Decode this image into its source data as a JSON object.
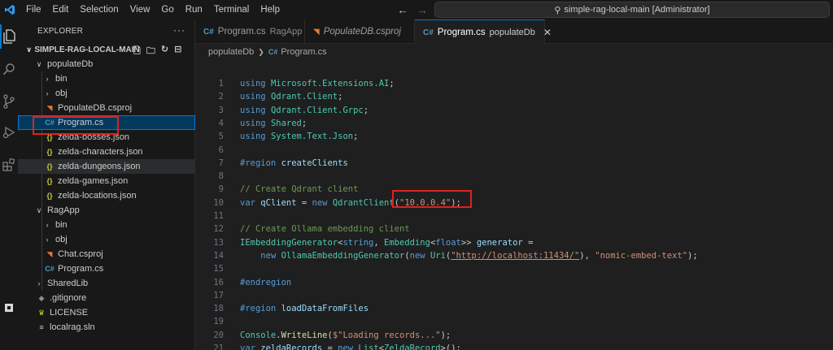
{
  "menu": [
    "File",
    "Edit",
    "Selection",
    "View",
    "Go",
    "Run",
    "Terminal",
    "Help"
  ],
  "command_center": "simple-rag-local-main [Administrator]",
  "explorer": {
    "title": "EXPLORER",
    "root": "SIMPLE-RAG-LOCAL-MAIN",
    "items": [
      {
        "label": "populateDb",
        "type": "folder-open",
        "depth": 1
      },
      {
        "label": "bin",
        "type": "folder",
        "depth": 2
      },
      {
        "label": "obj",
        "type": "folder",
        "depth": 2
      },
      {
        "label": "PopulateDB.csproj",
        "type": "csproj",
        "depth": 2
      },
      {
        "label": "Program.cs",
        "type": "cs",
        "depth": 2
      },
      {
        "label": "zelda-bosses.json",
        "type": "json",
        "depth": 2
      },
      {
        "label": "zelda-characters.json",
        "type": "json",
        "depth": 2
      },
      {
        "label": "zelda-dungeons.json",
        "type": "json",
        "depth": 2
      },
      {
        "label": "zelda-games.json",
        "type": "json",
        "depth": 2
      },
      {
        "label": "zelda-locations.json",
        "type": "json",
        "depth": 2
      },
      {
        "label": "RagApp",
        "type": "folder-open",
        "depth": 1
      },
      {
        "label": "bin",
        "type": "folder",
        "depth": 2
      },
      {
        "label": "obj",
        "type": "folder",
        "depth": 2
      },
      {
        "label": "Chat.csproj",
        "type": "csproj",
        "depth": 2
      },
      {
        "label": "Program.cs",
        "type": "cs",
        "depth": 2
      },
      {
        "label": "SharedLib",
        "type": "folder",
        "depth": 1
      },
      {
        "label": ".gitignore",
        "type": "git",
        "depth": 1
      },
      {
        "label": "LICENSE",
        "type": "license",
        "depth": 1
      },
      {
        "label": "localrag.sln",
        "type": "sln",
        "depth": 1
      }
    ]
  },
  "tabs": [
    {
      "name": "Program.cs",
      "desc": "RagApp",
      "icon": "cs"
    },
    {
      "name": "PopulateDB.csproj",
      "desc": "",
      "icon": "csproj"
    },
    {
      "name": "Program.cs",
      "desc": "populateDb",
      "icon": "cs",
      "active": true
    }
  ],
  "breadcrumb": [
    "populateDb",
    "Program.cs"
  ],
  "code_lines": [
    {
      "n": "1",
      "html": "<span class='kw'>using</span> <span class='ty'>Microsoft.Extensions.AI</span>;"
    },
    {
      "n": "2",
      "html": "<span class='kw'>using</span> <span class='ty'>Qdrant.Client</span>;"
    },
    {
      "n": "3",
      "html": "<span class='kw'>using</span> <span class='ty'>Qdrant.Client.Grpc</span>;"
    },
    {
      "n": "4",
      "html": "<span class='kw'>using</span> <span class='ty'>Shared</span>;"
    },
    {
      "n": "5",
      "html": "<span class='kw'>using</span> <span class='ty'>System.Text.Json</span>;"
    },
    {
      "n": "6",
      "html": ""
    },
    {
      "n": "7",
      "html": "<span class='rg'>#region</span> <span class='vr'>createClients</span>"
    },
    {
      "n": "8",
      "html": ""
    },
    {
      "n": "9",
      "html": "<span class='cm'>// Create Qdrant client</span>"
    },
    {
      "n": "10",
      "html": "<span class='kw'>var</span> <span class='vr'>qClient</span> = <span class='kw'>new</span> <span class='ty'>QdrantClient</span>(<span class='st'>\"10.0.0.4\"</span>);"
    },
    {
      "n": "11",
      "html": ""
    },
    {
      "n": "12",
      "html": "<span class='cm'>// Create Ollama embedding client</span>"
    },
    {
      "n": "13",
      "html": "<span class='ty'>IEmbeddingGenerator</span>&lt;<span class='kw'>string</span>, <span class='ty'>Embedding</span>&lt;<span class='kw'>float</span>&gt;&gt; <span class='vr'>generator</span> ="
    },
    {
      "n": "14",
      "html": "    <span class='kw'>new</span> <span class='ty'>OllamaEmbeddingGenerator</span>(<span class='kw'>new</span> <span class='ty'>Uri</span>(<span class='lk'>\"http://localhost:11434/\"</span>), <span class='st'>\"nomic-embed-text\"</span>);"
    },
    {
      "n": "15",
      "html": ""
    },
    {
      "n": "16",
      "html": "<span class='rg'>#endregion</span>"
    },
    {
      "n": "17",
      "html": ""
    },
    {
      "n": "18",
      "html": "<span class='rg'>#region</span> <span class='vr'>loadDataFromFiles</span>"
    },
    {
      "n": "19",
      "html": ""
    },
    {
      "n": "20",
      "html": "<span class='ty'>Console</span>.<span class='fn'>WriteLine</span>(<span class='st'>$\"Loading records...\"</span>);"
    },
    {
      "n": "21",
      "html": "<span class='kw'>var</span> <span class='vr'>zeldaRecords</span> = <span class='kw'>new</span> <span class='ty'>List</span>&lt;<span class='ty'>ZeldaRecord</span>&gt;();"
    }
  ],
  "colors": {
    "accent": "#0078d4",
    "highlight_box": "#e02020"
  }
}
